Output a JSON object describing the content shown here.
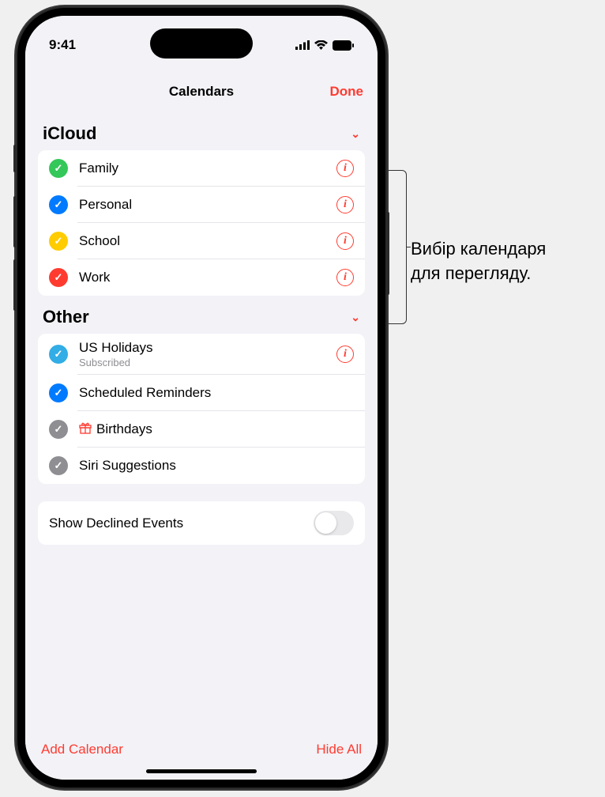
{
  "status": {
    "time": "9:41"
  },
  "sheet": {
    "title": "Calendars",
    "done": "Done"
  },
  "sections": [
    {
      "name": "iCloud",
      "items": [
        {
          "label": "Family",
          "color": "#34c759",
          "checked": true,
          "hasInfo": true
        },
        {
          "label": "Personal",
          "color": "#007aff",
          "checked": true,
          "hasInfo": true
        },
        {
          "label": "School",
          "color": "#ffcc00",
          "checked": true,
          "hasInfo": true
        },
        {
          "label": "Work",
          "color": "#ff3b30",
          "checked": true,
          "hasInfo": true
        }
      ]
    },
    {
      "name": "Other",
      "items": [
        {
          "label": "US Holidays",
          "subtitle": "Subscribed",
          "color": "#32ade6",
          "checked": true,
          "hasInfo": true
        },
        {
          "label": "Scheduled Reminders",
          "color": "#007aff",
          "checked": true,
          "hasInfo": false
        },
        {
          "label": "Birthdays",
          "color": "#8e8e93",
          "checked": true,
          "hasInfo": false,
          "iconPrefix": "gift"
        },
        {
          "label": "Siri Suggestions",
          "color": "#8e8e93",
          "checked": true,
          "hasInfo": false
        }
      ]
    }
  ],
  "toggle": {
    "label": "Show Declined Events",
    "on": false
  },
  "footer": {
    "add": "Add Calendar",
    "hide": "Hide All"
  },
  "callout": {
    "line1": "Вибір календаря",
    "line2": "для перегляду."
  }
}
